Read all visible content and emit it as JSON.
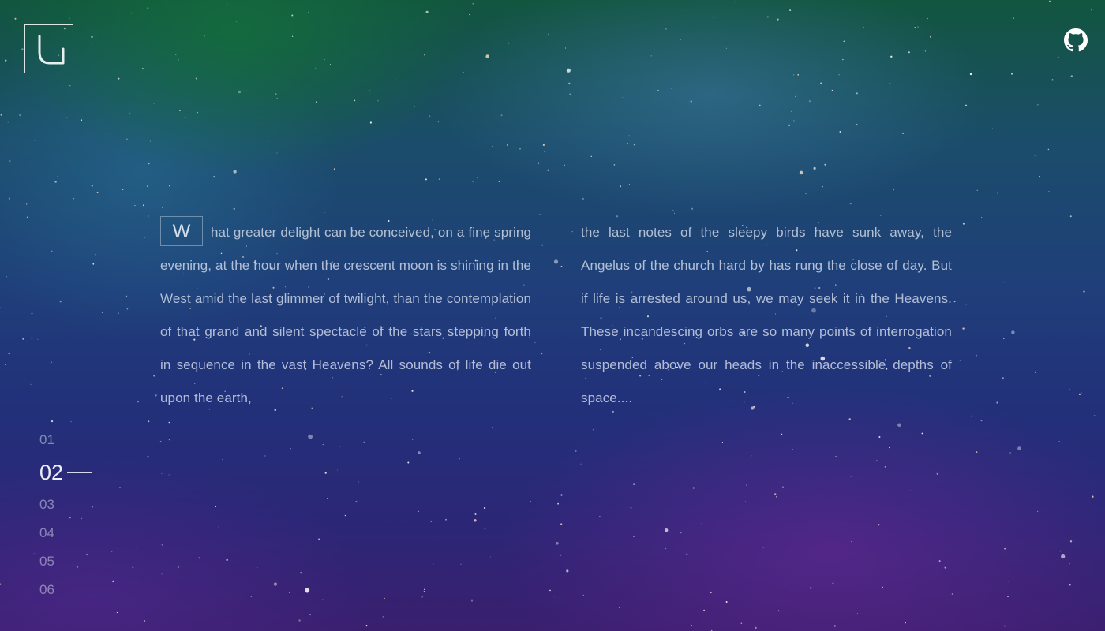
{
  "header": {
    "logo_icon": "u-logo-icon",
    "github_icon": "github-icon"
  },
  "article": {
    "drop_cap": "W",
    "column_1": "hat greater delight can be conceived, on a fine spring evening, at the hour when the crescent moon is shining in the West amid the last glimmer of twilight, than the contemplation of that grand and silent spectacle of the stars stepping forth in sequence in the vast Heavens? All sounds of life die out upon the earth,",
    "column_2": "the last notes of the sleepy birds have sunk away, the Angelus of the church hard by has rung the close of day. But if life is arrested around us, we may seek it in the Heavens. These incandescing orbs are so many points of interrogation suspended above our heads in the inaccessible depths of space...."
  },
  "pager": {
    "items": [
      "01",
      "02",
      "03",
      "04",
      "05",
      "06"
    ],
    "active": "02"
  },
  "colors": {
    "background_top": "#12563f",
    "background_mid": "#1f3f7a",
    "background_bottom": "#3a1f6f",
    "text": "#d7deee"
  }
}
